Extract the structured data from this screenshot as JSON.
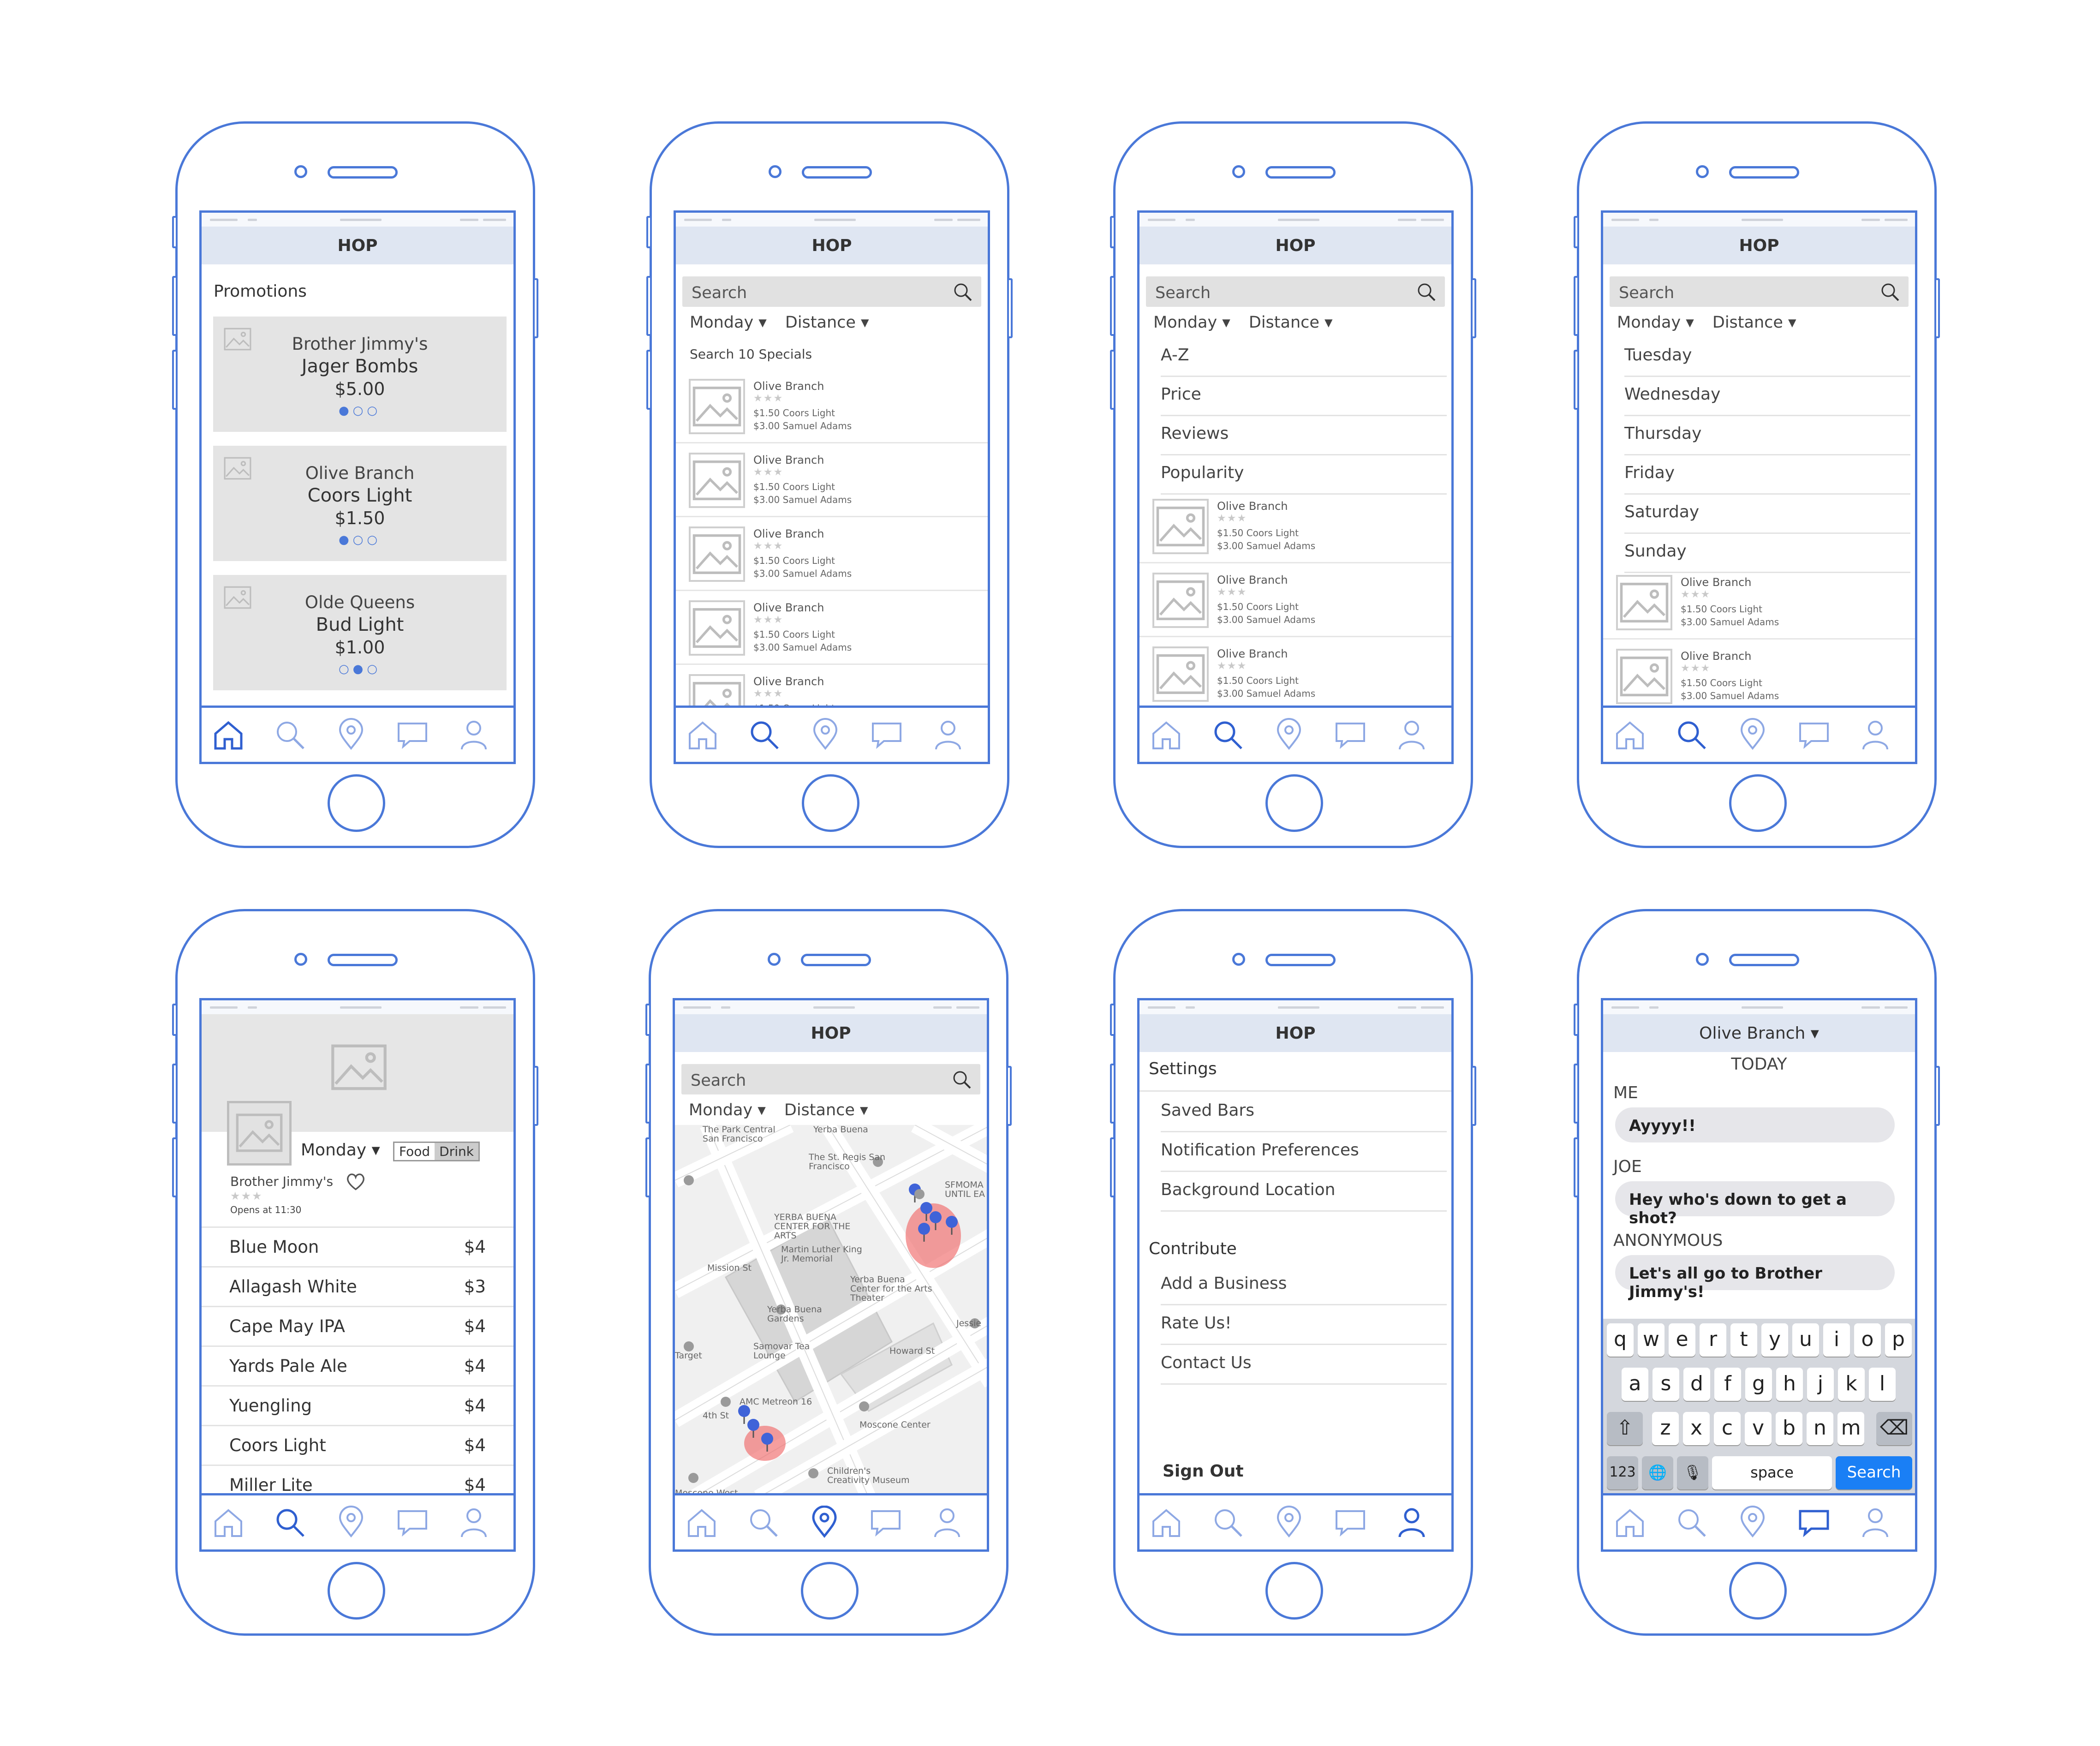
{
  "app_title": "HOP",
  "colors": {
    "accent": "#4a78d8",
    "topbar": "#dfe6f2",
    "card": "#e4e4e4",
    "key_action": "#1a7ff5",
    "pin": "#3f63d8",
    "heat": "#f06a6a"
  },
  "home": {
    "section_title": "Promotions",
    "promos": [
      {
        "line1": "Brother Jimmy's",
        "line2": "Jager Bombs",
        "price": "$5.00",
        "dots": "●○○"
      },
      {
        "line1": "Olive Branch",
        "line2": "Coors Light",
        "price": "$1.50",
        "dots": "●○○"
      },
      {
        "line1": "Olde Queens",
        "line2": "Bud Light",
        "price": "$1.00",
        "dots": "○●○"
      }
    ]
  },
  "search": {
    "placeholder": "Search",
    "day_filter": "Monday ▾",
    "sort_filter": "Distance ▾",
    "results_label": "Search 10 Specials",
    "item": {
      "name": "Olive Branch",
      "stars": "★★★",
      "special1": "$1.50 Coors Light",
      "special2": "$3.00 Samuel Adams"
    }
  },
  "sort_menu": [
    "A-Z",
    "Price",
    "Reviews",
    "Popularity"
  ],
  "day_menu": [
    "Tuesday",
    "Wednesday",
    "Thursday",
    "Friday",
    "Saturday",
    "Sunday"
  ],
  "bar_detail": {
    "day": "Monday ▾",
    "toggle_food": "Food",
    "toggle_drink": "Drink",
    "bar_name": "Brother Jimmy's",
    "stars": "★★★",
    "hours": "Opens at 11:30",
    "menu": [
      {
        "item": "Blue Moon",
        "price": "$4"
      },
      {
        "item": "Allagash White",
        "price": "$3"
      },
      {
        "item": "Cape May IPA",
        "price": "$4"
      },
      {
        "item": "Yards Pale Ale",
        "price": "$4"
      },
      {
        "item": "Yuengling",
        "price": "$4"
      },
      {
        "item": "Coors Light",
        "price": "$4"
      },
      {
        "item": "Miller Lite",
        "price": "$4"
      }
    ]
  },
  "map": {
    "labels": [
      "The Park Central San Francisco",
      "Yerba Buena",
      "The St. Regis San Francisco",
      "SFMOMA UNTIL EA",
      "YERBA BUENA CENTER FOR THE ARTS",
      "Martin Luther King Jr. Memorial",
      "Yerba Buena Center for the Arts Theater",
      "Yerba Buena Gardens",
      "Samovar Tea Lounge",
      "Mission St",
      "Howard St",
      "4th St",
      "AMC Metreon 16",
      "Moscone Center",
      "Children's Creativity Museum",
      "Moscone West",
      "Target",
      "Jessie"
    ]
  },
  "settings": {
    "title": "Settings",
    "items": [
      "Saved Bars",
      "Notification Preferences",
      "Background Location"
    ],
    "contribute_title": "Contribute",
    "contribute_items": [
      "Add a Business",
      "Rate Us!",
      "Contact Us"
    ],
    "sign_out": "Sign Out"
  },
  "chat": {
    "title": "Olive Branch ▾",
    "date": "TODAY",
    "messages": [
      {
        "sender": "ME",
        "text": "Ayyyy!!"
      },
      {
        "sender": "JOE",
        "text": "Hey who's down to get a shot?"
      },
      {
        "sender": "ANONYMOUS",
        "text": "Let's all go to Brother Jimmy's!"
      }
    ],
    "keyboard": {
      "row1": [
        "q",
        "w",
        "e",
        "r",
        "t",
        "y",
        "u",
        "i",
        "o",
        "p"
      ],
      "row2": [
        "a",
        "s",
        "d",
        "f",
        "g",
        "h",
        "j",
        "k",
        "l"
      ],
      "row3": [
        "z",
        "x",
        "c",
        "v",
        "b",
        "n",
        "m"
      ],
      "shift": "⇧",
      "backspace": "⌫",
      "numbers": "123",
      "globe": "🌐",
      "mic": "🎙",
      "space": "space",
      "action": "Search"
    }
  },
  "tabs": [
    "home-icon",
    "search-icon",
    "map-pin-icon",
    "chat-icon",
    "profile-icon"
  ]
}
